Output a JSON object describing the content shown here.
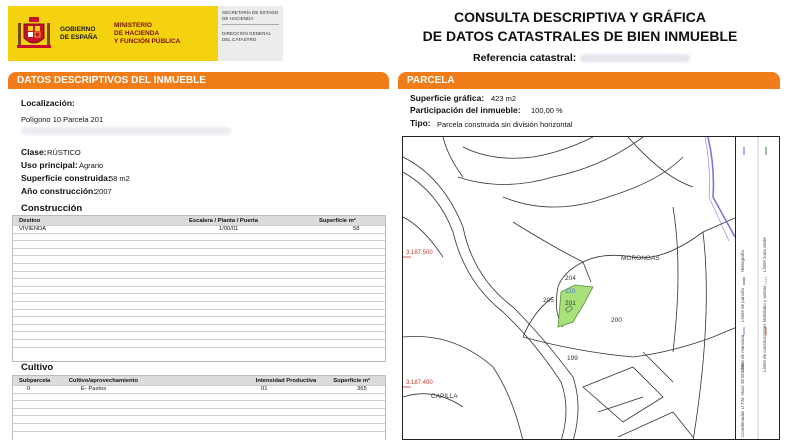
{
  "header": {
    "gov_name": "GOBIERNO\nDE ESPAÑA",
    "ministry": "MINISTERIO\nDE HACIENDA\nY FUNCIÓN PÚBLICA",
    "secretariat": "SECRETARÍA DE ESTADO DE HACIENDA",
    "directorate": "DIRECCIÓN GENERAL DEL CATASTRO",
    "title_line1": "CONSULTA DESCRIPTIVA Y GRÁFICA",
    "title_line2": "DE DATOS CATASTRALES DE BIEN INMUEBLE",
    "ref_label": "Referencia catastral:"
  },
  "left": {
    "section_title": "DATOS DESCRIPTIVOS DEL INMUEBLE",
    "localizacion_label": "Localización:",
    "localizacion_value": "Polígono 10 Parcela 201",
    "clase_label": "Clase:",
    "clase_value": "RÚSTICO",
    "uso_label": "Uso principal:",
    "uso_value": "Agrario",
    "sup_label": "Superficie construida:",
    "sup_value": "58 m2",
    "anio_label": "Año construcción:",
    "anio_value": "2007",
    "construccion": {
      "title": "Construcción",
      "headers": [
        "Destino",
        "Escalera / Planta / Puerta",
        "Superficie m²"
      ],
      "rows": [
        [
          "VIVIENDA",
          "1/00/01",
          "58"
        ]
      ]
    },
    "cultivo": {
      "title": "Cultivo",
      "headers": [
        "Subparcela",
        "Cultivo/aprovechamiento",
        "Intensidad Productiva",
        "Superficie m²"
      ],
      "rows": [
        [
          "0",
          "E- Pastos",
          "01",
          "365"
        ]
      ]
    }
  },
  "right": {
    "section_title": "PARCELA",
    "sup_grafica_label": "Superficie gráfica:",
    "sup_grafica_value": "423 m2",
    "participacion_label": "Participación del inmueble:",
    "participacion_value": "100,00 %",
    "tipo_label": "Tipo:",
    "tipo_value": "Parcela construida sin división horizontal",
    "map": {
      "coord_top": "3.187.500",
      "coord_bottom": "3.187.400",
      "place_morongas": "MORONGAS",
      "place_capilla": "CAPILLA",
      "parcels": [
        "204",
        "205",
        "201",
        "200",
        "199"
      ],
      "parcel_blue": "110",
      "highlight_color": "#a8e07a",
      "legend": [
        "Hidrografía",
        "Límite zona verde",
        "Límite de parcela",
        "Mobiliario y aceras",
        "Límite de manzana",
        "Límite de construcciones",
        "Coordenadas U.T.M. Huso 28 WGS84"
      ]
    }
  },
  "colors": {
    "accent": "#f07d1a",
    "gov_yellow": "#f4d20f"
  }
}
